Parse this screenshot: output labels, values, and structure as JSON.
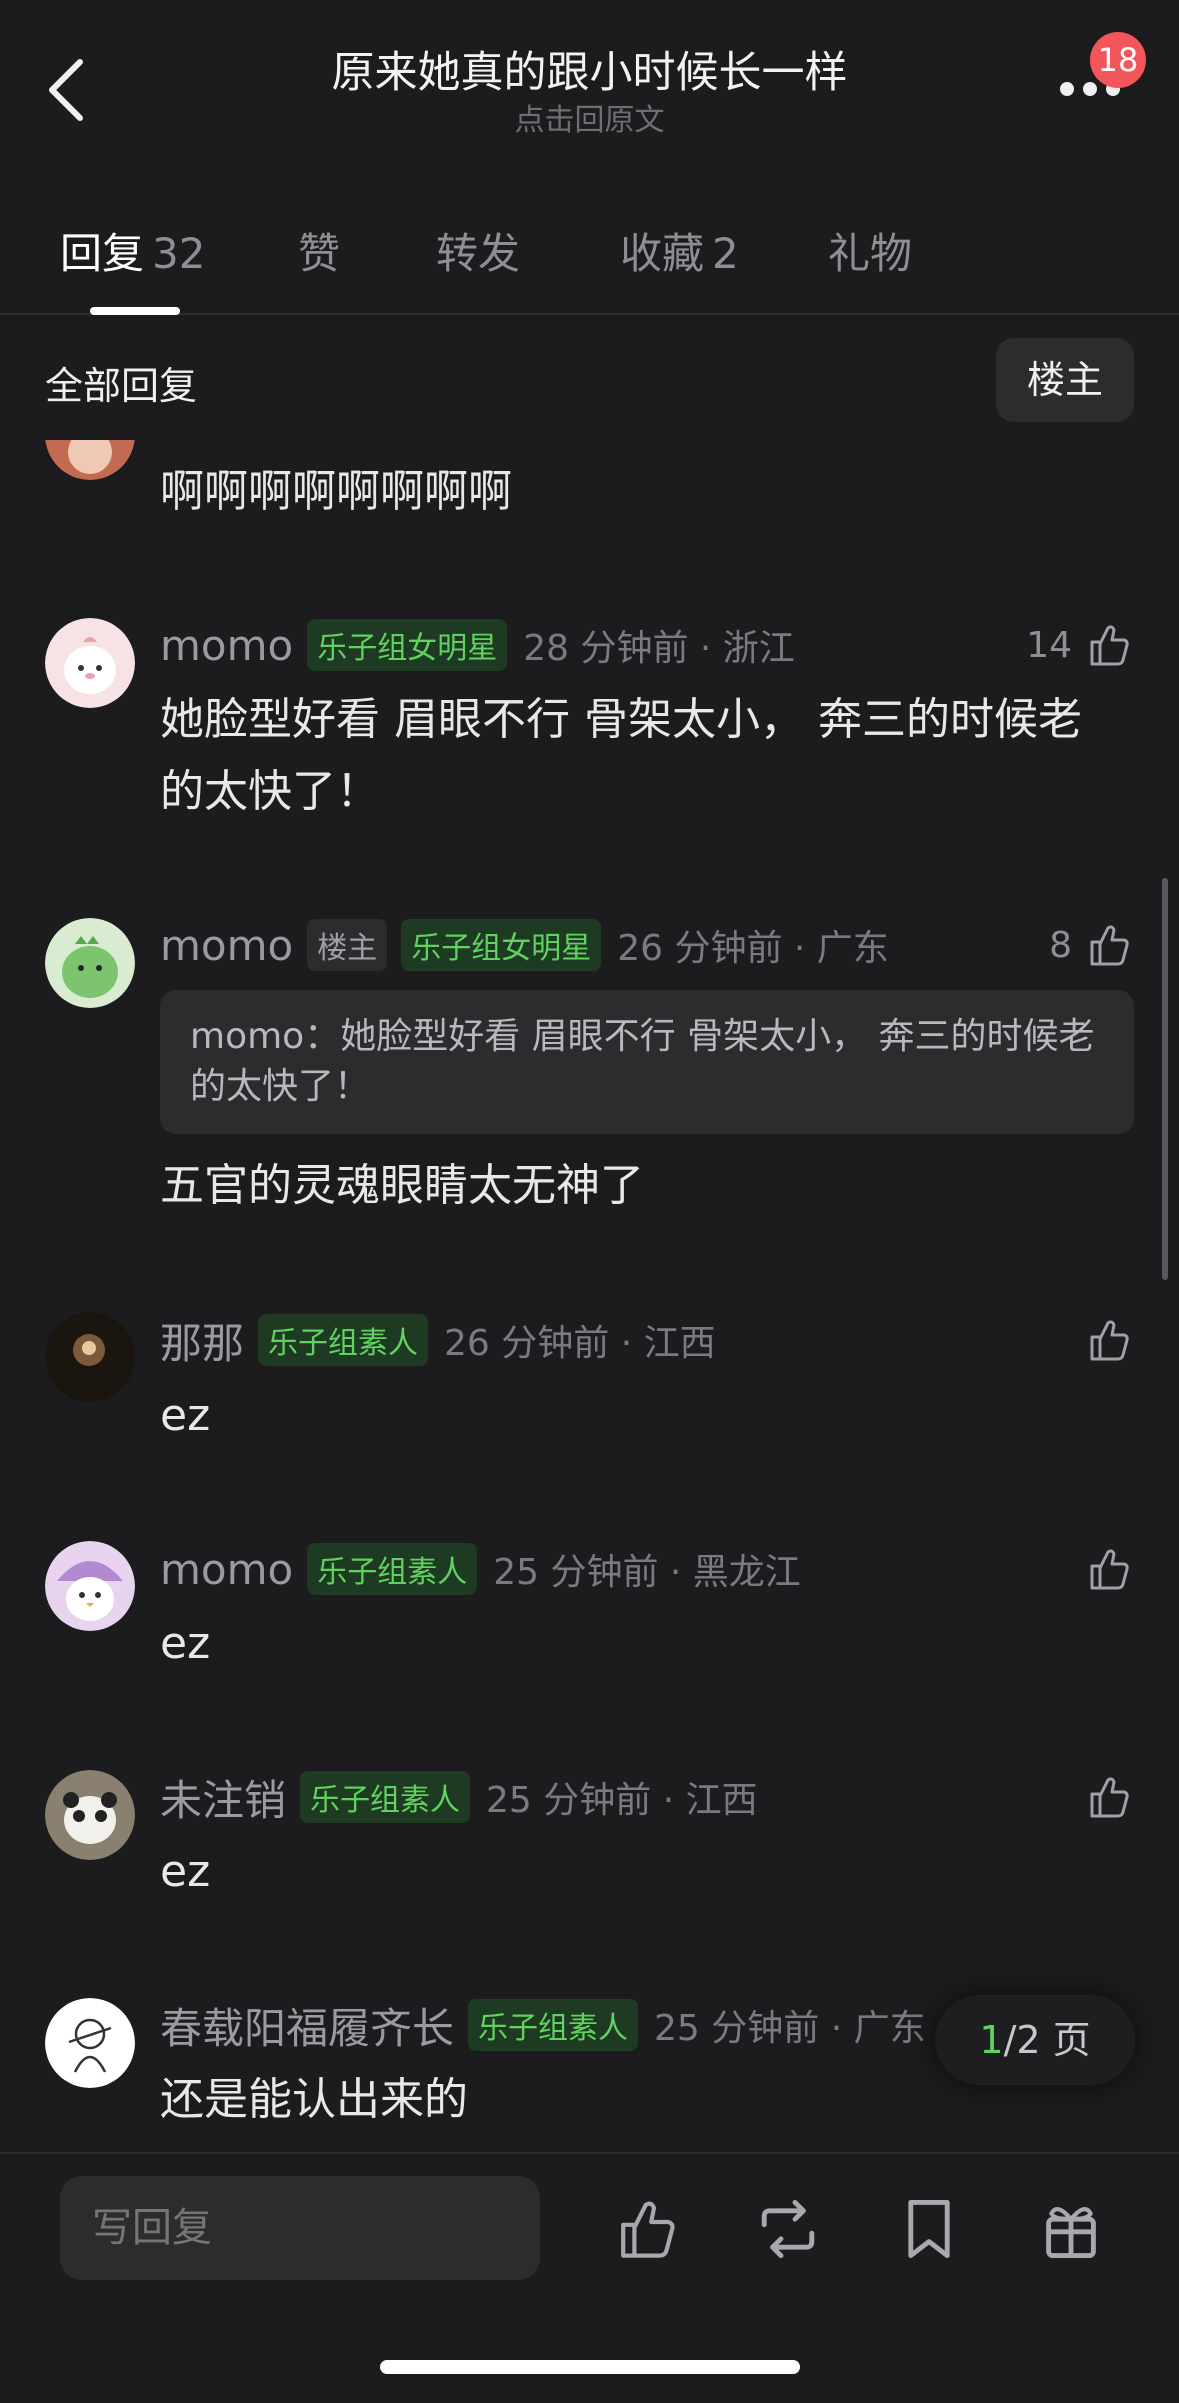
{
  "header": {
    "title": "原来她真的跟小时候长一样",
    "subtitle": "点击回原文",
    "notification_count": "18"
  },
  "tabs": [
    {
      "label": "回复",
      "count": "32",
      "active": true
    },
    {
      "label": "赞",
      "count": ""
    },
    {
      "label": "转发",
      "count": ""
    },
    {
      "label": "收藏",
      "count": "2"
    },
    {
      "label": "礼物",
      "count": ""
    }
  ],
  "filter": {
    "title": "全部回复",
    "op_button": "楼主"
  },
  "comments": [
    {
      "text": "啊啊啊啊啊啊啊啊"
    },
    {
      "username": "momo",
      "badge": "乐子组女明星",
      "time": "28 分钟前 · 浙江",
      "likes": "14",
      "text": "她脸型好看 眉眼不行 骨架太小， 奔三的时候老的太快了！"
    },
    {
      "username": "momo",
      "op_tag": "楼主",
      "badge": "乐子组女明星",
      "time": "26 分钟前 · 广东",
      "likes": "8",
      "quote": "momo：她脸型好看 眉眼不行 骨架太小， 奔三的时候老的太快了！",
      "text": "五官的灵魂眼睛太无神了"
    },
    {
      "username": "那那",
      "badge": "乐子组素人",
      "time": "26 分钟前 · 江西",
      "likes": "",
      "text": "ez"
    },
    {
      "username": "momo",
      "badge": "乐子组素人",
      "time": "25 分钟前 · 黑龙江",
      "likes": "",
      "text": "ez"
    },
    {
      "username": "未注销",
      "badge": "乐子组素人",
      "time": "25 分钟前 · 江西",
      "likes": "",
      "text": "ez"
    },
    {
      "username": "春载阳福履齐长",
      "badge": "乐子组素人",
      "time": "25 分钟前 · 广东",
      "likes": "",
      "text": "还是能认出来的"
    }
  ],
  "pager": {
    "current": "1",
    "total": "/2 页"
  },
  "bottom_bar": {
    "reply_placeholder": "写回复"
  },
  "colors": {
    "background": "#1c1c1e",
    "badge_green": "#5fd25f",
    "notification_red": "#f2555a"
  }
}
